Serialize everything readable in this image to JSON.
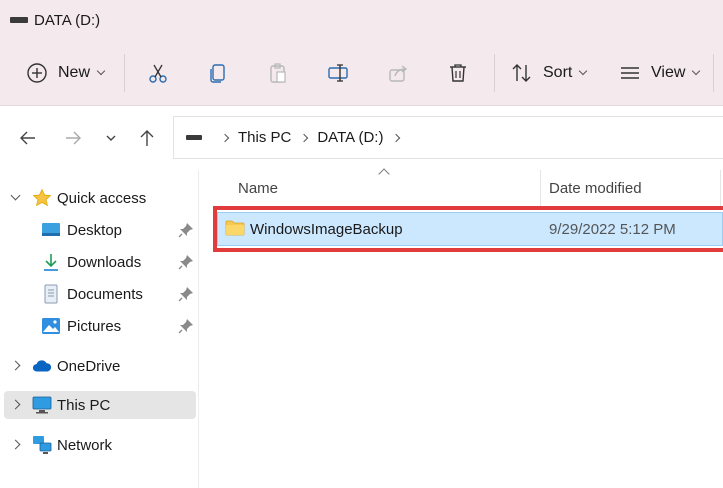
{
  "window": {
    "title": "DATA (D:)"
  },
  "toolbar": {
    "new_label": "New",
    "sort_label": "Sort",
    "view_label": "View",
    "icons": [
      "cut-icon",
      "copy-icon",
      "paste-icon",
      "rename-icon",
      "share-icon",
      "delete-icon"
    ]
  },
  "address": {
    "segments": [
      "This PC",
      "DATA (D:)"
    ]
  },
  "sidebar": {
    "quick_access": "Quick access",
    "items": [
      {
        "label": "Desktop",
        "icon": "desktop-icon"
      },
      {
        "label": "Downloads",
        "icon": "downloads-icon"
      },
      {
        "label": "Documents",
        "icon": "documents-icon"
      },
      {
        "label": "Pictures",
        "icon": "pictures-icon"
      }
    ],
    "onedrive": "OneDrive",
    "thispc": "This PC",
    "network": "Network"
  },
  "columns": {
    "name": "Name",
    "date": "Date modified"
  },
  "files": [
    {
      "name": "WindowsImageBackup",
      "date": "9/29/2022 5:12 PM",
      "selected": true
    }
  ],
  "colors": {
    "accent": "#0067c0",
    "selection": "#cce8ff",
    "highlight": "#e23b3b",
    "folder": "#f8c851"
  }
}
